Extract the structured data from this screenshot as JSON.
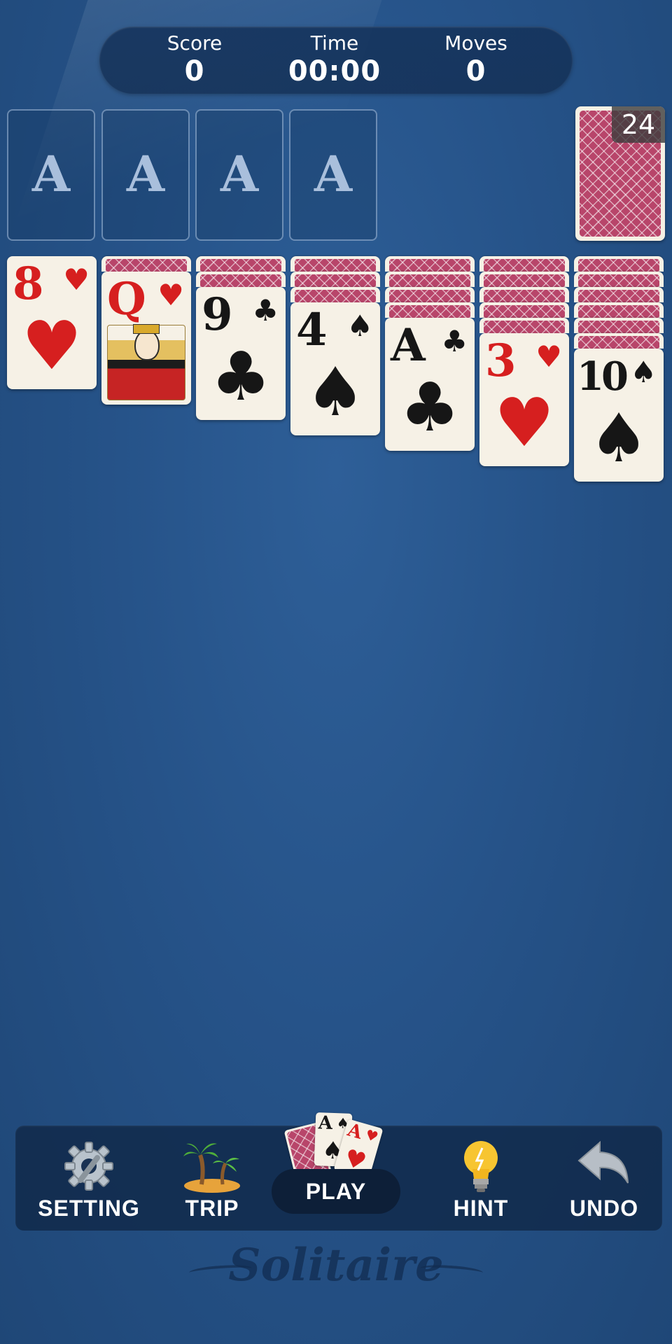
{
  "header": {
    "score_label": "Score",
    "score_value": "0",
    "time_label": "Time",
    "time_value": "00:00",
    "moves_label": "Moves",
    "moves_value": "0"
  },
  "foundations": [
    "A",
    "A",
    "A",
    "A"
  ],
  "stock": {
    "count": "24"
  },
  "tableau": [
    {
      "hidden": 0,
      "rank": "8",
      "suit": "♥",
      "color": "red"
    },
    {
      "hidden": 1,
      "rank": "Q",
      "suit": "♥",
      "color": "red"
    },
    {
      "hidden": 2,
      "rank": "9",
      "suit": "♣",
      "color": "black"
    },
    {
      "hidden": 3,
      "rank": "4",
      "suit": "♠",
      "color": "black"
    },
    {
      "hidden": 4,
      "rank": "A",
      "suit": "♣",
      "color": "black"
    },
    {
      "hidden": 5,
      "rank": "3",
      "suit": "♥",
      "color": "red"
    },
    {
      "hidden": 6,
      "rank": "10",
      "suit": "♠",
      "color": "black"
    }
  ],
  "toolbar": {
    "setting": "SETTING",
    "trip": "TRIP",
    "play": "PLAY",
    "hint": "HINT",
    "undo": "UNDO"
  },
  "play_cards": [
    {
      "rank": "A",
      "suit": "♠",
      "color": "black"
    },
    {
      "rank": "A",
      "suit": "♥",
      "color": "red"
    }
  ],
  "footer": {
    "logo": "Solitaire"
  },
  "colors": {
    "felt": "#265389",
    "card_back": "#b8456a",
    "red": "#d61f1f"
  }
}
